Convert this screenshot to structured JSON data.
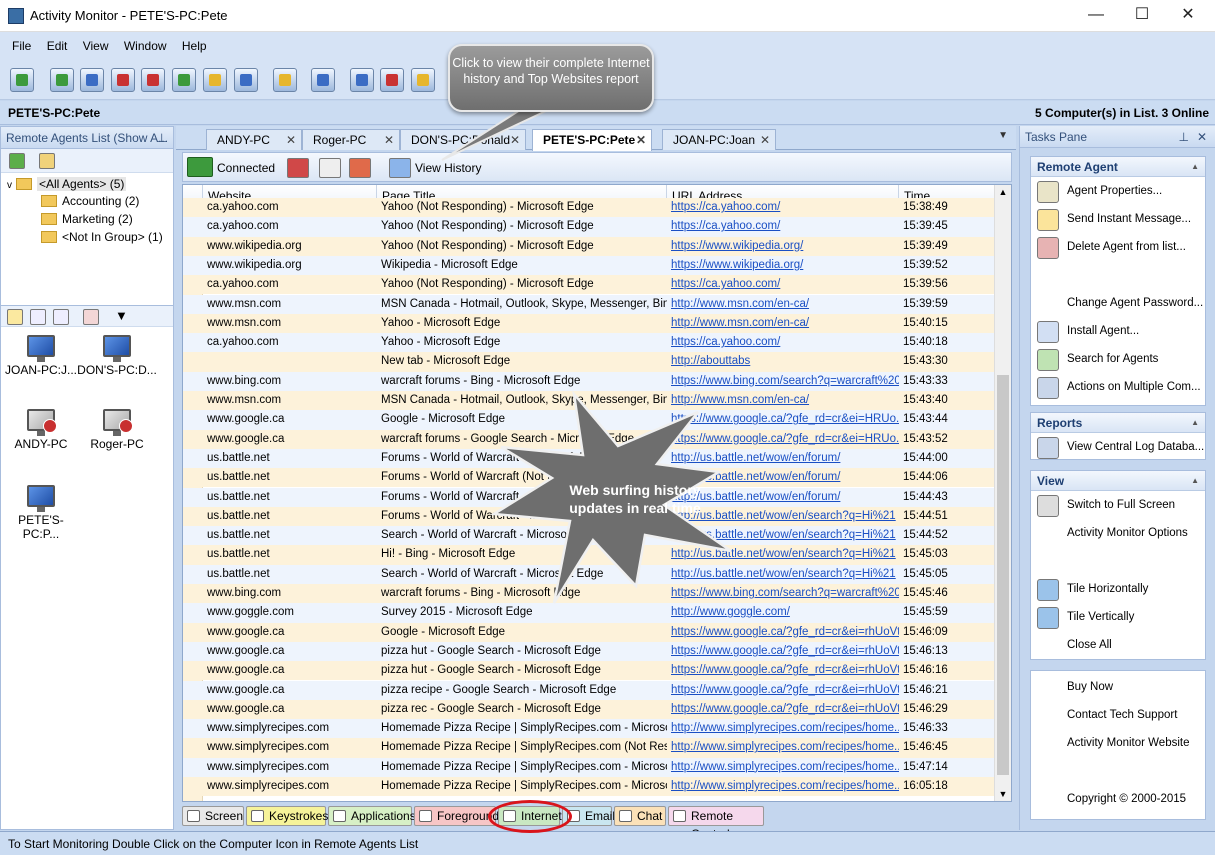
{
  "window": {
    "title": "Activity Monitor - PETE'S-PC:Pete"
  },
  "menu": [
    "File",
    "Edit",
    "View",
    "Window",
    "Help"
  ],
  "path_bar": {
    "current": "PETE'S-PC:Pete",
    "summary": "5 Computer(s) in List. 3 Online"
  },
  "left_panel": {
    "title": "Remote Agents List (Show A...",
    "tree": [
      {
        "label": "<All Agents> (5)",
        "level": 0
      },
      {
        "label": "Accounting (2)",
        "level": 1
      },
      {
        "label": "Marketing (2)",
        "level": 1
      },
      {
        "label": "<Not In Group> (1)",
        "level": 1
      }
    ],
    "agents": [
      {
        "label": "JOAN-PC:J...",
        "online": true
      },
      {
        "label": "DON'S-PC:D...",
        "online": true
      },
      {
        "label": "ANDY-PC",
        "online": false
      },
      {
        "label": "Roger-PC",
        "online": false
      },
      {
        "label": "PETE'S-PC:P...",
        "online": true
      }
    ]
  },
  "tabs": [
    {
      "label": "ANDY-PC"
    },
    {
      "label": "Roger-PC"
    },
    {
      "label": "DON'S-PC:Donald"
    },
    {
      "label": "PETE'S-PC:Pete",
      "active": true
    },
    {
      "label": "JOAN-PC:Joan"
    }
  ],
  "subtoolbar": {
    "connected": "Connected",
    "view_history": "View History"
  },
  "grid": {
    "columns": [
      "Website",
      "Page Title",
      "URL Address",
      "Time"
    ],
    "rows": [
      [
        "ca.yahoo.com",
        "Yahoo (Not Responding) - Microsoft Edge",
        "https://ca.yahoo.com/",
        "15:38:49"
      ],
      [
        "ca.yahoo.com",
        "Yahoo (Not Responding) - Microsoft Edge",
        "https://ca.yahoo.com/",
        "15:39:45"
      ],
      [
        "www.wikipedia.org",
        "Yahoo (Not Responding) - Microsoft Edge",
        "https://www.wikipedia.org/",
        "15:39:49"
      ],
      [
        "www.wikipedia.org",
        "Wikipedia - Microsoft Edge",
        "https://www.wikipedia.org/",
        "15:39:52"
      ],
      [
        "ca.yahoo.com",
        "Yahoo (Not Responding) - Microsoft Edge",
        "https://ca.yahoo.com/",
        "15:39:56"
      ],
      [
        "www.msn.com",
        "MSN Canada - Hotmail, Outlook, Skype, Messenger, Bing...",
        "http://www.msn.com/en-ca/",
        "15:39:59"
      ],
      [
        "www.msn.com",
        "Yahoo - Microsoft Edge",
        "http://www.msn.com/en-ca/",
        "15:40:15"
      ],
      [
        "ca.yahoo.com",
        "Yahoo - Microsoft Edge",
        "https://ca.yahoo.com/",
        "15:40:18"
      ],
      [
        "",
        "New tab - Microsoft Edge",
        "http://abouttabs",
        "15:43:30"
      ],
      [
        "www.bing.com",
        "warcraft forums - Bing - Microsoft Edge",
        "https://www.bing.com/search?q=warcraft%20...",
        "15:43:33"
      ],
      [
        "www.msn.com",
        "MSN Canada - Hotmail, Outlook, Skype, Messenger, Bing...",
        "http://www.msn.com/en-ca/",
        "15:43:40"
      ],
      [
        "www.google.ca",
        "Google - Microsoft Edge",
        "https://www.google.ca/?gfe_rd=cr&ei=HRUo...",
        "15:43:44"
      ],
      [
        "www.google.ca",
        "warcraft forums - Google Search - Microsoft Edge",
        "https://www.google.ca/?gfe_rd=cr&ei=HRUo...",
        "15:43:52"
      ],
      [
        "us.battle.net",
        "Forums - World of Warcraft - Microsoft Edge",
        "http://us.battle.net/wow/en/forum/",
        "15:44:00"
      ],
      [
        "us.battle.net",
        "Forums - World of Warcraft (Not Responding) - Microsoft Edge",
        "http://us.battle.net/wow/en/forum/",
        "15:44:06"
      ],
      [
        "us.battle.net",
        "Forums - World of Warcraft - Microsoft Edge",
        "http://us.battle.net/wow/en/forum/",
        "15:44:43"
      ],
      [
        "us.battle.net",
        "Forums - World of Warcraft - Microsoft Edge",
        "http://us.battle.net/wow/en/search?q=Hi%21",
        "15:44:51"
      ],
      [
        "us.battle.net",
        "Search - World of Warcraft - Microsoft Edge",
        "http://us.battle.net/wow/en/search?q=Hi%21",
        "15:44:52"
      ],
      [
        "us.battle.net",
        "Hi! - Bing - Microsoft Edge",
        "http://us.battle.net/wow/en/search?q=Hi%21",
        "15:45:03"
      ],
      [
        "us.battle.net",
        "Search - World of Warcraft - Microsoft Edge",
        "http://us.battle.net/wow/en/search?q=Hi%21",
        "15:45:05"
      ],
      [
        "www.bing.com",
        "warcraft forums - Bing - Microsoft Edge",
        "https://www.bing.com/search?q=warcraft%20...",
        "15:45:46"
      ],
      [
        "www.goggle.com",
        "Survey 2015 - Microsoft Edge",
        "http://www.goggle.com/",
        "15:45:59"
      ],
      [
        "www.google.ca",
        "Google - Microsoft Edge",
        "https://www.google.ca/?gfe_rd=cr&ei=rhUoVtf...",
        "15:46:09"
      ],
      [
        "www.google.ca",
        "pizza hut - Google Search - Microsoft Edge",
        "https://www.google.ca/?gfe_rd=cr&ei=rhUoVtf...",
        "15:46:13"
      ],
      [
        "www.google.ca",
        "pizza hut - Google Search - Microsoft Edge",
        "https://www.google.ca/?gfe_rd=cr&ei=rhUoVtf...",
        "15:46:16"
      ],
      [
        "www.google.ca",
        "pizza recipe - Google Search - Microsoft Edge",
        "https://www.google.ca/?gfe_rd=cr&ei=rhUoVtf...",
        "15:46:21"
      ],
      [
        "www.google.ca",
        "pizza rec - Google Search - Microsoft Edge",
        "https://www.google.ca/?gfe_rd=cr&ei=rhUoVtf...",
        "15:46:29"
      ],
      [
        "www.simplyrecipes.com",
        "Homemade Pizza Recipe | SimplyRecipes.com - Microso...",
        "http://www.simplyrecipes.com/recipes/home...",
        "15:46:33"
      ],
      [
        "www.simplyrecipes.com",
        "Homemade Pizza Recipe | SimplyRecipes.com (Not Res...",
        "http://www.simplyrecipes.com/recipes/home...",
        "15:46:45"
      ],
      [
        "www.simplyrecipes.com",
        "Homemade Pizza Recipe | SimplyRecipes.com - Microso...",
        "http://www.simplyrecipes.com/recipes/home...",
        "15:47:14"
      ],
      [
        "www.simplyrecipes.com",
        "Homemade Pizza Recipe | SimplyRecipes.com - Microso...",
        "http://www.simplyrecipes.com/recipes/home...",
        "16:05:18"
      ]
    ]
  },
  "bottom_tabs": [
    {
      "label": "Screen",
      "color": "#e9e9e9"
    },
    {
      "label": "Keystrokes",
      "color": "#f6f39a"
    },
    {
      "label": "Applications",
      "color": "#d7f0c6"
    },
    {
      "label": "Foreground",
      "color": "#f7c6c6"
    },
    {
      "label": "Internet",
      "color": "#c9e8c2"
    },
    {
      "label": "Email",
      "color": "#c9e6f0"
    },
    {
      "label": "Chat",
      "color": "#fbe1b8"
    },
    {
      "label": "Remote Control",
      "color": "#f5d8ec"
    }
  ],
  "tasks_pane": {
    "title": "Tasks Pane",
    "remote_agent": {
      "title": "Remote Agent",
      "items": [
        "Agent Properties...",
        "Send Instant Message...",
        "Delete Agent from list...",
        "Change Agent Password...",
        "Install Agent...",
        "Search for Agents",
        "Actions on Multiple Com..."
      ]
    },
    "reports": {
      "title": "Reports",
      "items": [
        "View Central Log Databa..."
      ]
    },
    "view": {
      "title": "View",
      "items": [
        "Switch to Full Screen",
        "Activity Monitor Options",
        "Tile Horizontally",
        "Tile Vertically",
        "Close All"
      ]
    },
    "links": [
      "Buy Now",
      "Contact Tech Support",
      "Activity Monitor Website",
      "Copyright © 2000-2015"
    ]
  },
  "status": "To Start Monitoring Double Click on the Computer Icon in Remote Agents List",
  "callouts": {
    "history": "Click to view their complete Internet history and Top Websites report",
    "realtime": "Web surfing history updates in real time"
  }
}
